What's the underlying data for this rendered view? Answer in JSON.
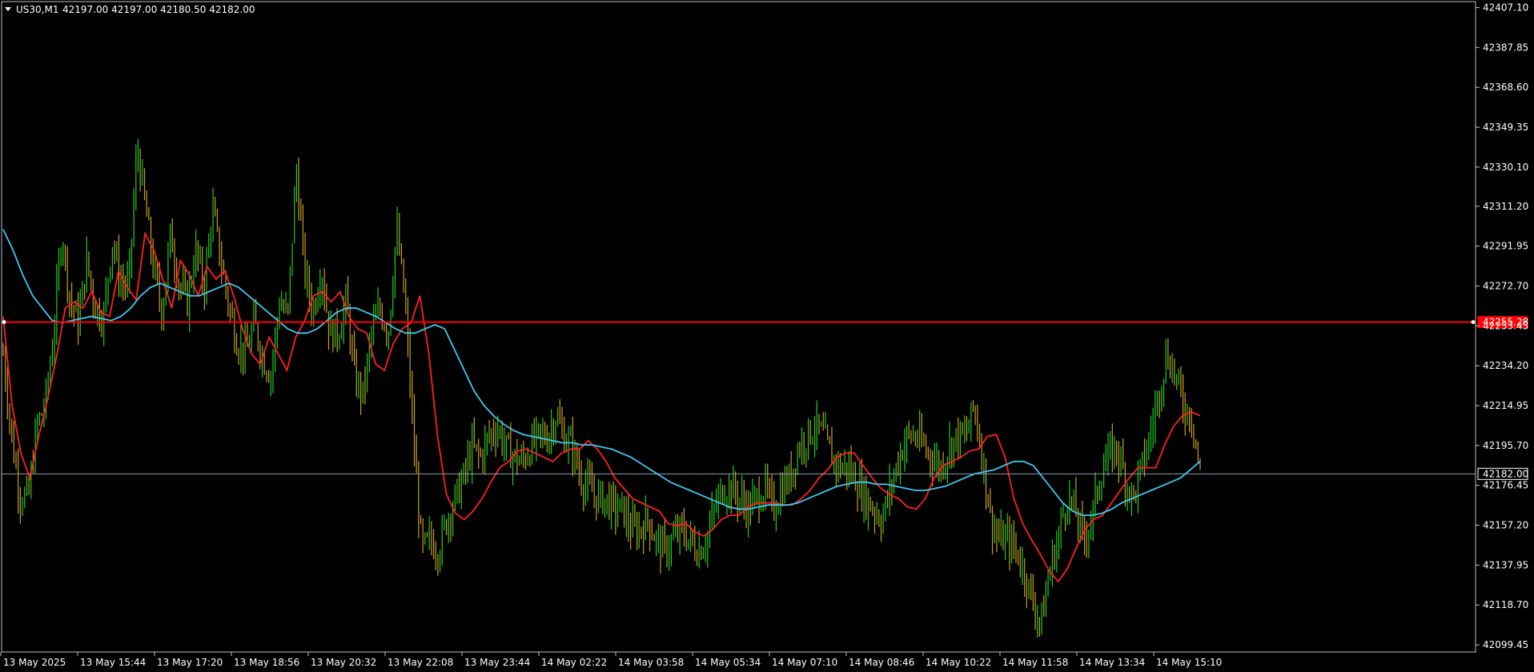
{
  "header": {
    "symbol": "US30,M1",
    "ohlc": "42197.00 42197.00 42180.50 42182.00"
  },
  "colors": {
    "background": "#000000",
    "frame": "#c0c0c0",
    "candle_up": "#22cc22",
    "candle_down": "#c8a020",
    "ma_fast": "#ff2020",
    "ma_slow": "#3ec8f0",
    "level_line": "#ff0000",
    "bid_line": "#8c9eb5"
  },
  "chart_data": {
    "type": "line",
    "title": "US30,M1",
    "grid": false,
    "y_ticks": [
      "42407.10",
      "42387.85",
      "42368.60",
      "42349.35",
      "42330.10",
      "42311.20",
      "42291.95",
      "42272.70",
      "42253.45",
      "42234.20",
      "42214.95",
      "42195.70",
      "42176.45",
      "42157.20",
      "42137.95",
      "42118.70",
      "42099.45"
    ],
    "ylim": [
      42096,
      42410
    ],
    "x_ticks": [
      "13 May 2025",
      "13 May 15:44",
      "13 May 17:20",
      "13 May 18:56",
      "13 May 20:32",
      "13 May 22:08",
      "13 May 23:44",
      "14 May 02:22",
      "14 May 03:58",
      "14 May 05:34",
      "14 May 07:10",
      "14 May 08:46",
      "14 May 10:22",
      "14 May 11:58",
      "14 May 13:34",
      "14 May 15:10"
    ],
    "horizontal_lines": [
      {
        "name": "level",
        "value": 42255.28,
        "label": "42255.28"
      },
      {
        "name": "bid",
        "value": 42182.0,
        "label": "42182.00"
      }
    ],
    "series": [
      {
        "name": "price",
        "values": [
          42240,
          42200,
          42172,
          42170,
          42205,
          42215,
          42248,
          42300,
          42265,
          42255,
          42285,
          42262,
          42258,
          42295,
          42275,
          42272,
          42340,
          42310,
          42280,
          42260,
          42298,
          42274,
          42265,
          42290,
          42272,
          42310,
          42285,
          42262,
          42245,
          42240,
          42255,
          42238,
          42230,
          42265,
          42258,
          42330,
          42280,
          42260,
          42282,
          42250,
          42250,
          42266,
          42228,
          42220,
          42250,
          42262,
          42250,
          42300,
          42265,
          42200,
          42145,
          42150,
          42145,
          42160,
          42170,
          42180,
          42195,
          42190,
          42200,
          42205,
          42195,
          42190,
          42188,
          42195,
          42200,
          42200,
          42210,
          42200,
          42195,
          42180,
          42175,
          42170,
          42170,
          42165,
          42165,
          42155,
          42155,
          42160,
          42150,
          42145,
          42150,
          42155,
          42150,
          42145,
          42150,
          42165,
          42175,
          42175,
          42170,
          42165,
          42170,
          42175,
          42165,
          42175,
          42180,
          42195,
          42200,
          42205,
          42200,
          42190,
          42185,
          42185,
          42178,
          42170,
          42165,
          42160,
          42175,
          42190,
          42200,
          42200,
          42195,
          42190,
          42185,
          42195,
          42200,
          42200,
          42215,
          42190,
          42160,
          42150,
          42150,
          42145,
          42135,
          42120,
          42110,
          42135,
          42150,
          42170,
          42165,
          42150,
          42160,
          42180,
          42190,
          42195,
          42180,
          42170,
          42185,
          42200,
          42220,
          42240,
          42230,
          42215,
          42210,
          42182
        ]
      },
      {
        "name": "ma_fast",
        "values": [
          42258,
          42215,
          42192,
          42180,
          42200,
          42218,
          42238,
          42262,
          42265,
          42262,
          42270,
          42260,
          42258,
          42280,
          42272,
          42266,
          42298,
          42290,
          42276,
          42262,
          42285,
          42278,
          42268,
          42282,
          42276,
          42280,
          42268,
          42252,
          42240,
          42235,
          42248,
          42240,
          42232,
          42248,
          42256,
          42268,
          42270,
          42265,
          42270,
          42258,
          42252,
          42250,
          42235,
          42232,
          42245,
          42252,
          42255,
          42268,
          42240,
          42200,
          42172,
          42163,
          42160,
          42164,
          42170,
          42178,
          42185,
          42188,
          42193,
          42194,
          42192,
          42190,
          42188,
          42192,
          42194,
          42194,
          42198,
          42194,
          42188,
          42180,
          42175,
          42170,
          42168,
          42166,
          42164,
          42158,
          42157,
          42158,
          42154,
          42152,
          42155,
          42160,
          42162,
          42162,
          42166,
          42168,
          42168,
          42168,
          42167,
          42167,
          42170,
          42174,
          42180,
          42184,
          42190,
          42192,
          42192,
          42186,
          42180,
          42175,
          42172,
          42170,
          42166,
          42165,
          42170,
          42180,
          42186,
          42188,
          42190,
          42193,
          42194,
          42200,
          42201,
          42190,
          42170,
          42158,
          42150,
          42143,
          42135,
          42130,
          42136,
          42146,
          42155,
          42160,
          42162,
          42168,
          42174,
          42180,
          42185,
          42185,
          42185,
          42196,
          42205,
          42210,
          42212,
          42210
        ]
      },
      {
        "name": "ma_slow",
        "values": [
          42300,
          42290,
          42278,
          42268,
          42262,
          42256,
          42255,
          42256,
          42257,
          42258,
          42257,
          42256,
          42258,
          42262,
          42268,
          42272,
          42274,
          42272,
          42270,
          42268,
          42268,
          42270,
          42272,
          42274,
          42272,
          42268,
          42264,
          42260,
          42256,
          42252,
          42250,
          42250,
          42252,
          42256,
          42260,
          42262,
          42262,
          42260,
          42258,
          42255,
          42252,
          42250,
          42250,
          42252,
          42254,
          42252,
          42242,
          42232,
          42222,
          42215,
          42210,
          42206,
          42203,
          42201,
          42200,
          42199,
          42198,
          42197,
          42197,
          42196,
          42196,
          42195,
          42194,
          42192,
          42190,
          42187,
          42184,
          42181,
          42178,
          42176,
          42174,
          42172,
          42170,
          42168,
          42166,
          42165,
          42165,
          42166,
          42167,
          42167,
          42167,
          42168,
          42170,
          42172,
          42174,
          42176,
          42177,
          42178,
          42178,
          42177,
          42177,
          42176,
          42175,
          42174,
          42174,
          42175,
          42176,
          42178,
          42180,
          42182,
          42183,
          42184,
          42186,
          42188,
          42188,
          42186,
          42180,
          42174,
          42168,
          42164,
          42162,
          42162,
          42163,
          42165,
          42168,
          42170,
          42172,
          42174,
          42176,
          42178,
          42180,
          42184,
          42188
        ]
      }
    ]
  }
}
